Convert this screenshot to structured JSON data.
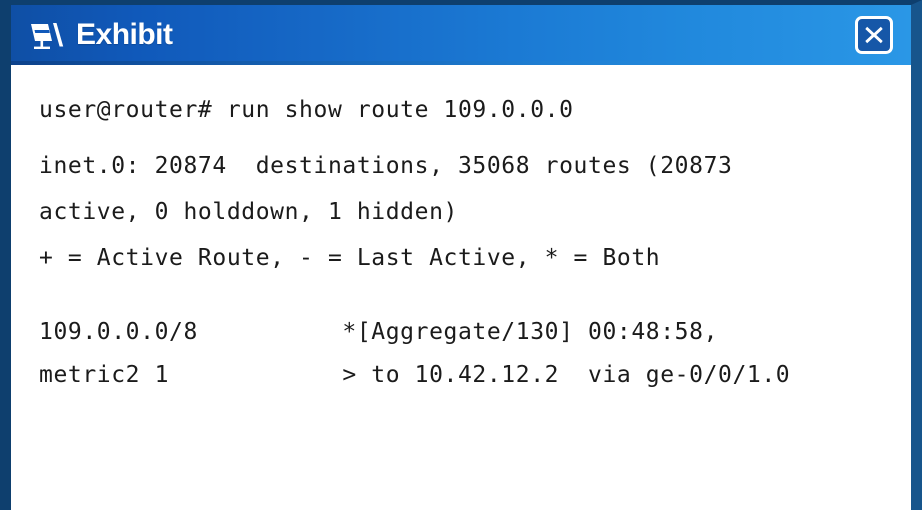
{
  "window": {
    "title": "Exhibit",
    "icon": "exhibit-easel-icon",
    "close_label": "✕",
    "accent_dark": "#0e3f6e",
    "accent_mid": "#1059ba",
    "accent_light": "#2a97e6",
    "body_background": "#ffffff",
    "text_color": "#1b1b1b"
  },
  "terminal": {
    "lines": [
      "user@router# run show route 109.0.0.0",
      "",
      "inet.0: 20874  destinations, 35068 routes (20873",
      "active, 0 holddown, 1 hidden)",
      "+ = Active Route, - = Last Active, * = Both",
      "",
      "109.0.0.0/8          *[Aggregate/130] 00:48:58,",
      "metric2 1            > to 10.42.12.2  via ge-0/0/1.0"
    ],
    "prompt": "user@router#",
    "command": "run show route 109.0.0.0",
    "table": "inet.0",
    "destinations": "20874",
    "routes": "35068",
    "active": "20873",
    "holddown": "0",
    "hidden": "1",
    "legend": "+ = Active Route, - = Last Active, * = Both",
    "route_prefix": "109.0.0.0/8",
    "route_protocol": "Aggregate",
    "route_preference": "130",
    "route_age": "00:48:58",
    "route_metric2": "1",
    "next_hop": "10.42.12.2",
    "interface": "ge-0/0/1.0"
  }
}
